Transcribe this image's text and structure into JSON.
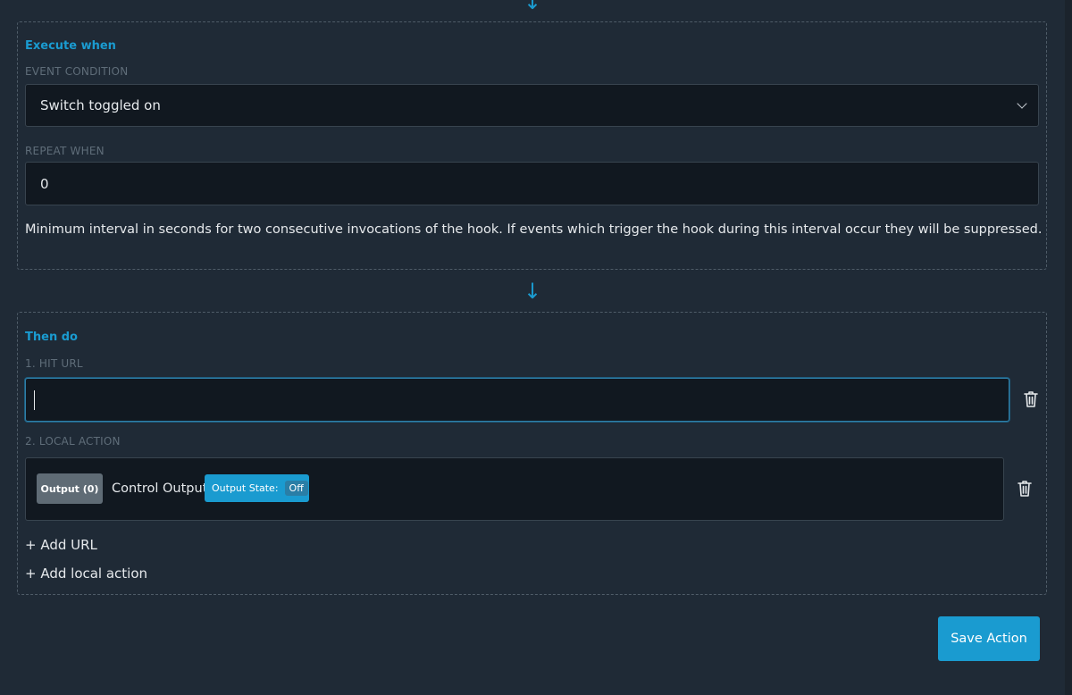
{
  "execute_when": {
    "title": "Execute when",
    "event_condition_label": "EVENT CONDITION",
    "event_condition_value": "Switch toggled on",
    "repeat_when_label": "REPEAT WHEN",
    "repeat_when_value": "0",
    "help_text": "Minimum interval in seconds for two consecutive invocations of the hook. If events which trigger the hook during this interval occur they will be suppressed."
  },
  "then_do": {
    "title": "Then do",
    "hit_url_label": "1. HIT URL",
    "hit_url_value": "",
    "local_action_label": "2. LOCAL ACTION",
    "output_badge": "Output (0)",
    "control_label": "Control Output",
    "state_label": "Output State:",
    "state_value": "Off",
    "add_url": "+ Add URL",
    "add_local_action": "+ Add local action"
  },
  "save_button": "Save Action",
  "colors": {
    "accent": "#1a9bd0",
    "panel": "#1f2a36",
    "input_bg": "#111820"
  }
}
